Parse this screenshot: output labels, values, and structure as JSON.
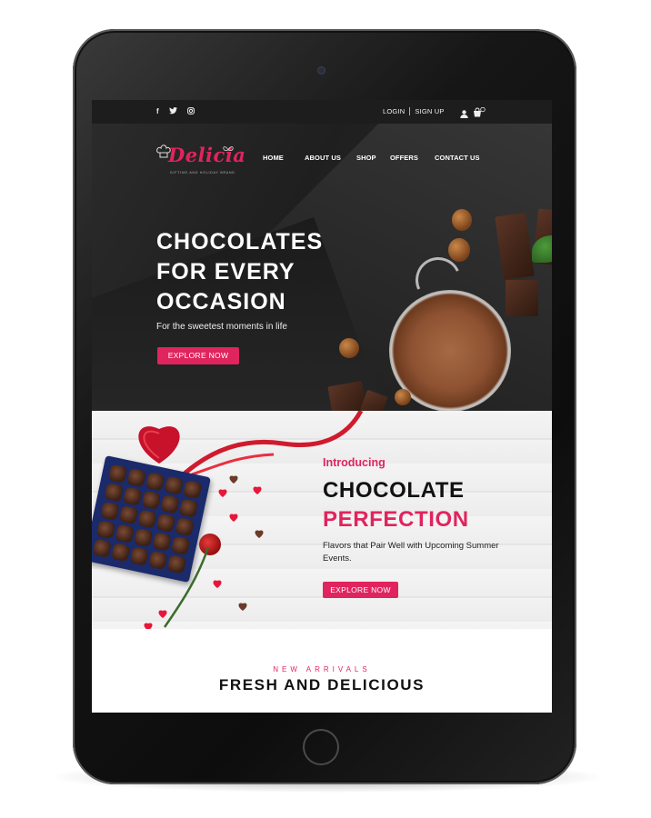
{
  "topbar": {
    "social_icons": [
      "facebook-icon",
      "twitter-icon",
      "instagram-icon"
    ],
    "login_label": "LOGIN",
    "signup_label": "SIGN UP",
    "cart_count": "0"
  },
  "brand": {
    "name": "Delicia",
    "tagline": "GIFTING AND HOLIDAY BRAND"
  },
  "nav": {
    "items": [
      "HOME",
      "ABOUT US",
      "SHOP",
      "OFFERS",
      "CONTACT US"
    ]
  },
  "hero": {
    "title_line1": "CHOCOLATES",
    "title_line2": "FOR EVERY",
    "title_line3": "OCCASION",
    "subtitle": "For the sweetest moments in life",
    "cta_label": "EXPLORE NOW"
  },
  "promo": {
    "intro": "Introducing",
    "heading_black": "CHOCOLATE",
    "heading_pink": "PERFECTION",
    "description": "Flavors that Pair Well with Upcoming Summer Events.",
    "cta_label": "EXPLORE NOW"
  },
  "arrivals": {
    "kicker": "NEW ARRIVALS",
    "heading": "FRESH AND DELICIOUS"
  },
  "colors": {
    "accent": "#e0245e",
    "dark": "#1d1d1d"
  }
}
